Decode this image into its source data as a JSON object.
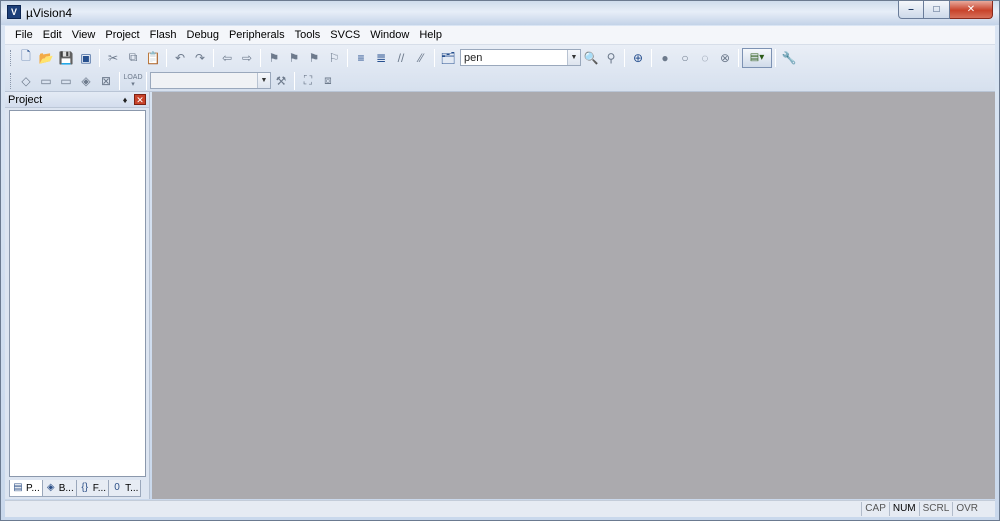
{
  "window": {
    "title": "µVision4",
    "app_icon_glyph": "V",
    "controls": {
      "minimize": "–",
      "maximize": "□",
      "close": "✕"
    }
  },
  "menu": [
    "File",
    "Edit",
    "View",
    "Project",
    "Flash",
    "Debug",
    "Peripherals",
    "Tools",
    "SVCS",
    "Window",
    "Help"
  ],
  "toolbar": {
    "find_combo_value": "pen",
    "target_combo_value": "",
    "combo_arrow": "▼",
    "row1_icons": [
      "new-file-icon",
      "open-file-icon",
      "save-icon",
      "save-all-icon",
      "cut-icon",
      "copy-icon",
      "paste-icon",
      "undo-icon",
      "redo-icon",
      "nav-back-icon",
      "nav-forward-icon",
      "bookmark-icon",
      "prev-bookmark-icon",
      "next-bookmark-icon",
      "clear-bookmarks-icon",
      "indent-icon",
      "unindent-icon",
      "comment-icon",
      "uncomment-icon",
      "find-in-files-icon"
    ],
    "row1_icons_b": [
      "incremental-find-icon",
      "find-icon",
      "debug-session-icon",
      "breakpoint-icon",
      "disable-breakpoint-icon",
      "disable-all-breakpoints-icon",
      "kill-breakpoints-icon",
      "window-select-icon",
      "configure-icon"
    ],
    "row2_icons": [
      "translate-icon",
      "build-icon",
      "rebuild-icon",
      "batch-build-icon",
      "stop-build-icon",
      "download-icon",
      "target-options-icon",
      "manage-components-icon",
      "file-extensions-icon"
    ],
    "load_label": "LOAD"
  },
  "project_pane": {
    "title": "Project",
    "pin_glyph": "♦",
    "close_glyph": "✕",
    "tabs": [
      {
        "label": "P...",
        "icon": "project-tab-icon",
        "glyph": "▤"
      },
      {
        "label": "B...",
        "icon": "books-tab-icon",
        "glyph": "◈"
      },
      {
        "label": "F...",
        "icon": "functions-tab-icon",
        "glyph": "{}"
      },
      {
        "label": "T...",
        "icon": "templates-tab-icon",
        "glyph": "0"
      }
    ]
  },
  "statusbar": {
    "indicators": [
      {
        "label": "CAP",
        "on": false
      },
      {
        "label": "NUM",
        "on": true
      },
      {
        "label": "SCRL",
        "on": false
      },
      {
        "label": "OVR",
        "on": false
      }
    ]
  }
}
